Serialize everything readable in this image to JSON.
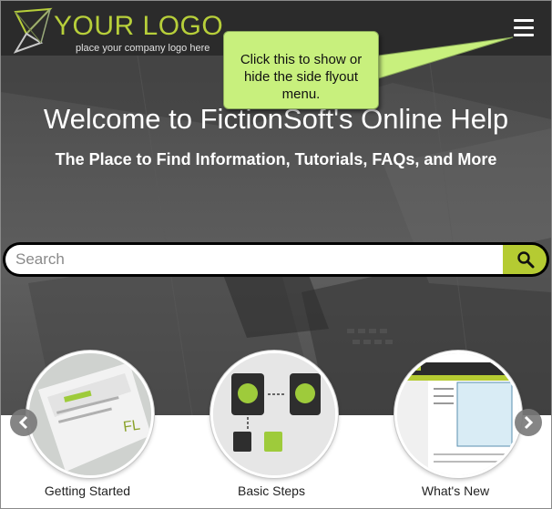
{
  "header": {
    "logo_text": "YOUR LOGO",
    "logo_tagline": "place your company logo here",
    "menu_icon": "hamburger-menu-icon"
  },
  "callout": {
    "text": "Click this to show or hide the side flyout menu."
  },
  "hero": {
    "title": "Welcome to FictionSoft's Online Help",
    "subtitle": "The Place to Find Information, Tutorials, FAQs, and More"
  },
  "search": {
    "placeholder": "Search",
    "value": "",
    "icon": "search-icon"
  },
  "carousel": {
    "items": [
      {
        "label": "Getting Started"
      },
      {
        "label": "Basic Steps"
      },
      {
        "label": "What's New"
      }
    ],
    "prev_icon": "chevron-left-icon",
    "next_icon": "chevron-right-icon"
  },
  "colors": {
    "accent": "#b5cb32",
    "header_bg": "#2b2b2b",
    "callout_bg": "#c8f07d"
  }
}
